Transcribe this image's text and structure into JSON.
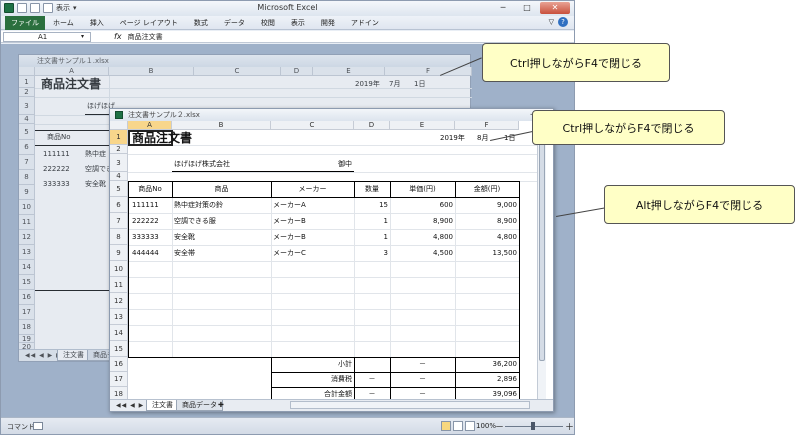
{
  "app": {
    "title": "Microsoft Excel",
    "qat_display_label": "表示",
    "window_buttons": [
      "─",
      "□",
      "✕"
    ],
    "ribbon_tabs": [
      "ファイル",
      "ホーム",
      "挿入",
      "ページ レイアウト",
      "数式",
      "データ",
      "校閲",
      "表示",
      "開発",
      "アドイン"
    ],
    "name_box": "A1",
    "fx": "fx",
    "formula_value": "商品注文書",
    "status_label": "コマンド",
    "zoom_label": "100%",
    "zoom_minus": "－",
    "zoom_plus": "＋"
  },
  "wb1": {
    "title": "注文書サンプル１.xlsx",
    "columns": [
      "A",
      "B",
      "C",
      "D",
      "E",
      "F"
    ],
    "rows": [
      "1",
      "2",
      "3",
      "4",
      "5",
      "6",
      "7",
      "8",
      "9",
      "10",
      "11",
      "12",
      "13",
      "14",
      "15",
      "16",
      "17",
      "18",
      "19",
      "20"
    ],
    "heading": "商品注文書",
    "date_year": "2019年",
    "date_month": "7月",
    "date_day": "1日",
    "company_partial": "ほげほげ",
    "hdr_no": "商品No",
    "r1_no": "111111",
    "r1_item": "熱中症",
    "r2_no": "222222",
    "r2_item": "空調でき",
    "r3_no": "333333",
    "r3_item": "安全靴",
    "tab1": "注文書",
    "tab2": "商品デ"
  },
  "wb2": {
    "title": "注文書サンプル２.xlsx",
    "window_buttons": [
      "─",
      "⧉"
    ],
    "columns": [
      "A",
      "B",
      "C",
      "D",
      "E",
      "F"
    ],
    "rows": [
      "1",
      "2",
      "3",
      "4",
      "5",
      "6",
      "7",
      "8",
      "9",
      "10",
      "11",
      "12",
      "13",
      "14",
      "15",
      "16",
      "17",
      "18"
    ],
    "heading": "商品注文書",
    "date_year": "2019年",
    "date_month": "8月",
    "date_day": "1日",
    "company": "ほげほげ株式会社",
    "onchu": "御中",
    "table_headers": [
      "商品No",
      "商品",
      "メーカー",
      "数量",
      "単価(円)",
      "金額(円)"
    ],
    "items": [
      {
        "no": "111111",
        "name": "熱中症対策の鈴",
        "maker": "メーカーA",
        "qty": "15",
        "price": "600",
        "amount": "9,000"
      },
      {
        "no": "222222",
        "name": "空調できる服",
        "maker": "メーカーB",
        "qty": "1",
        "price": "8,900",
        "amount": "8,900"
      },
      {
        "no": "333333",
        "name": "安全靴",
        "maker": "メーカーB",
        "qty": "1",
        "price": "4,800",
        "amount": "4,800"
      },
      {
        "no": "444444",
        "name": "安全帯",
        "maker": "メーカーC",
        "qty": "3",
        "price": "4,500",
        "amount": "13,500"
      }
    ],
    "subtotal_label": "小計",
    "subtotal_dash": "－",
    "subtotal_value": "36,200",
    "tax_label": "消費税",
    "tax_dash1": "－",
    "tax_dash2": "－",
    "tax_value": "2,896",
    "total_label": "合計金額",
    "total_dash1": "－",
    "total_dash2": "－",
    "total_value": "39,096",
    "tab1": "注文書",
    "tab2": "商品データ"
  },
  "callouts": {
    "c1": "Ctrl押しながらF4で閉じる",
    "c2": "Ctrl押しながらF4で閉じる",
    "c3": "Alt押しながらF4で閉じる"
  }
}
